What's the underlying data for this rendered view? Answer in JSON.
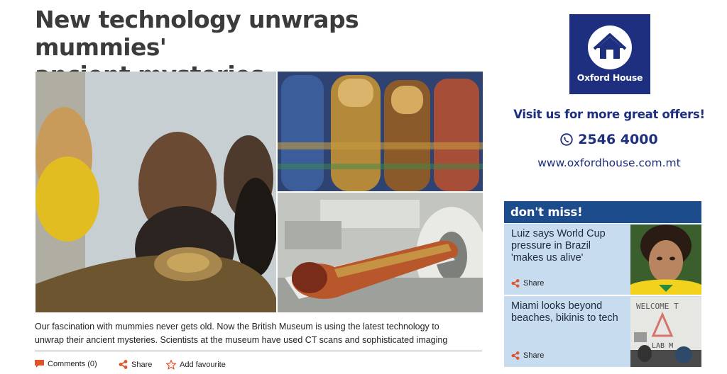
{
  "article": {
    "headline_line1": "New technology unwraps mummies'",
    "headline_line2": "ancient mysteries",
    "summary_line1": "Our fascination with mummies never gets old. Now the British Museum is using the latest technology to",
    "summary_line2": "unwrap their ancient mysteries. Scientists at the museum have used CT scans and sophisticated imaging",
    "actions": {
      "comments": "Comments (0)",
      "share": "Share",
      "favourite": "Add favourite"
    }
  },
  "sidebar": {
    "ad": {
      "brand": "Oxford House",
      "tagline": "Visit us for more great offers!",
      "phone": "2546 4000",
      "website": "www.oxfordhouse.com.mt"
    },
    "dont_miss": {
      "title": "don't miss!",
      "items": [
        {
          "title": "Luiz says World Cup pressure in Brazil 'makes us alive'",
          "share": "Share"
        },
        {
          "title": "Miami looks beyond beaches, bikinis to tech",
          "share": "Share",
          "thumb_text": "WELCOME T",
          "thumb_sub": "LAB M"
        }
      ]
    }
  },
  "colors": {
    "brand_navy": "#1d2f7e",
    "dont_miss_header": "#1c4c8c",
    "dont_miss_item_bg": "#c7dcef",
    "action_icon": "#e0542b"
  }
}
